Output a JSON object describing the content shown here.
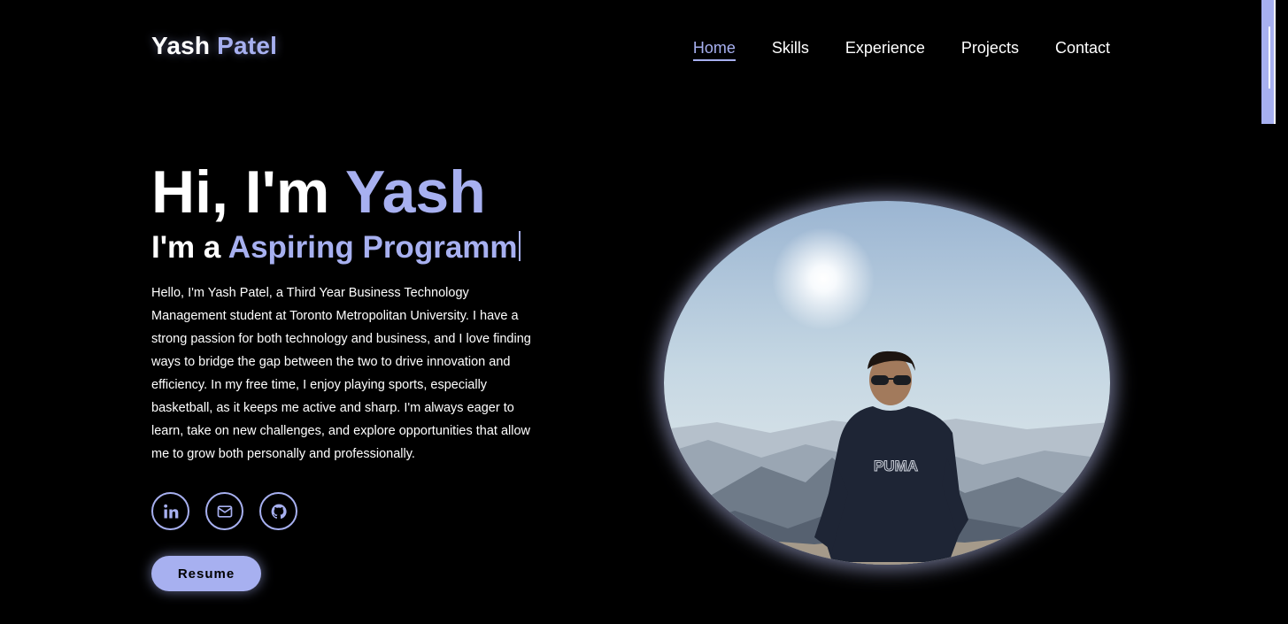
{
  "brand": {
    "first": "Yash",
    "last": "Patel"
  },
  "nav": {
    "items": [
      {
        "label": "Home",
        "active": true
      },
      {
        "label": "Skills",
        "active": false
      },
      {
        "label": "Experience",
        "active": false
      },
      {
        "label": "Projects",
        "active": false
      },
      {
        "label": "Contact",
        "active": false
      }
    ]
  },
  "hero": {
    "greeting": "Hi, I'm",
    "name": "Yash",
    "role_prefix": "I'm a",
    "role_typed": "Aspiring Programm",
    "bio": "Hello, I'm Yash Patel, a Third Year Business Technology Management student at Toronto Metropolitan University. I have a strong passion for both technology and business, and I love finding ways to bridge the gap between the two to drive innovation and efficiency. In my free time, I enjoy playing sports, especially basketball, as it keeps me active and sharp. I'm always eager to learn, take on new challenges, and explore opportunities that allow me to grow both personally and professionally."
  },
  "socials": [
    {
      "icon": "linkedin-icon"
    },
    {
      "icon": "mail-icon"
    },
    {
      "icon": "github-icon"
    }
  ],
  "resume_label": "Resume",
  "photo": {
    "shirt_text": "PUMA"
  },
  "colors": {
    "accent": "#a7b0f0",
    "background": "#000000",
    "text": "#ffffff"
  }
}
